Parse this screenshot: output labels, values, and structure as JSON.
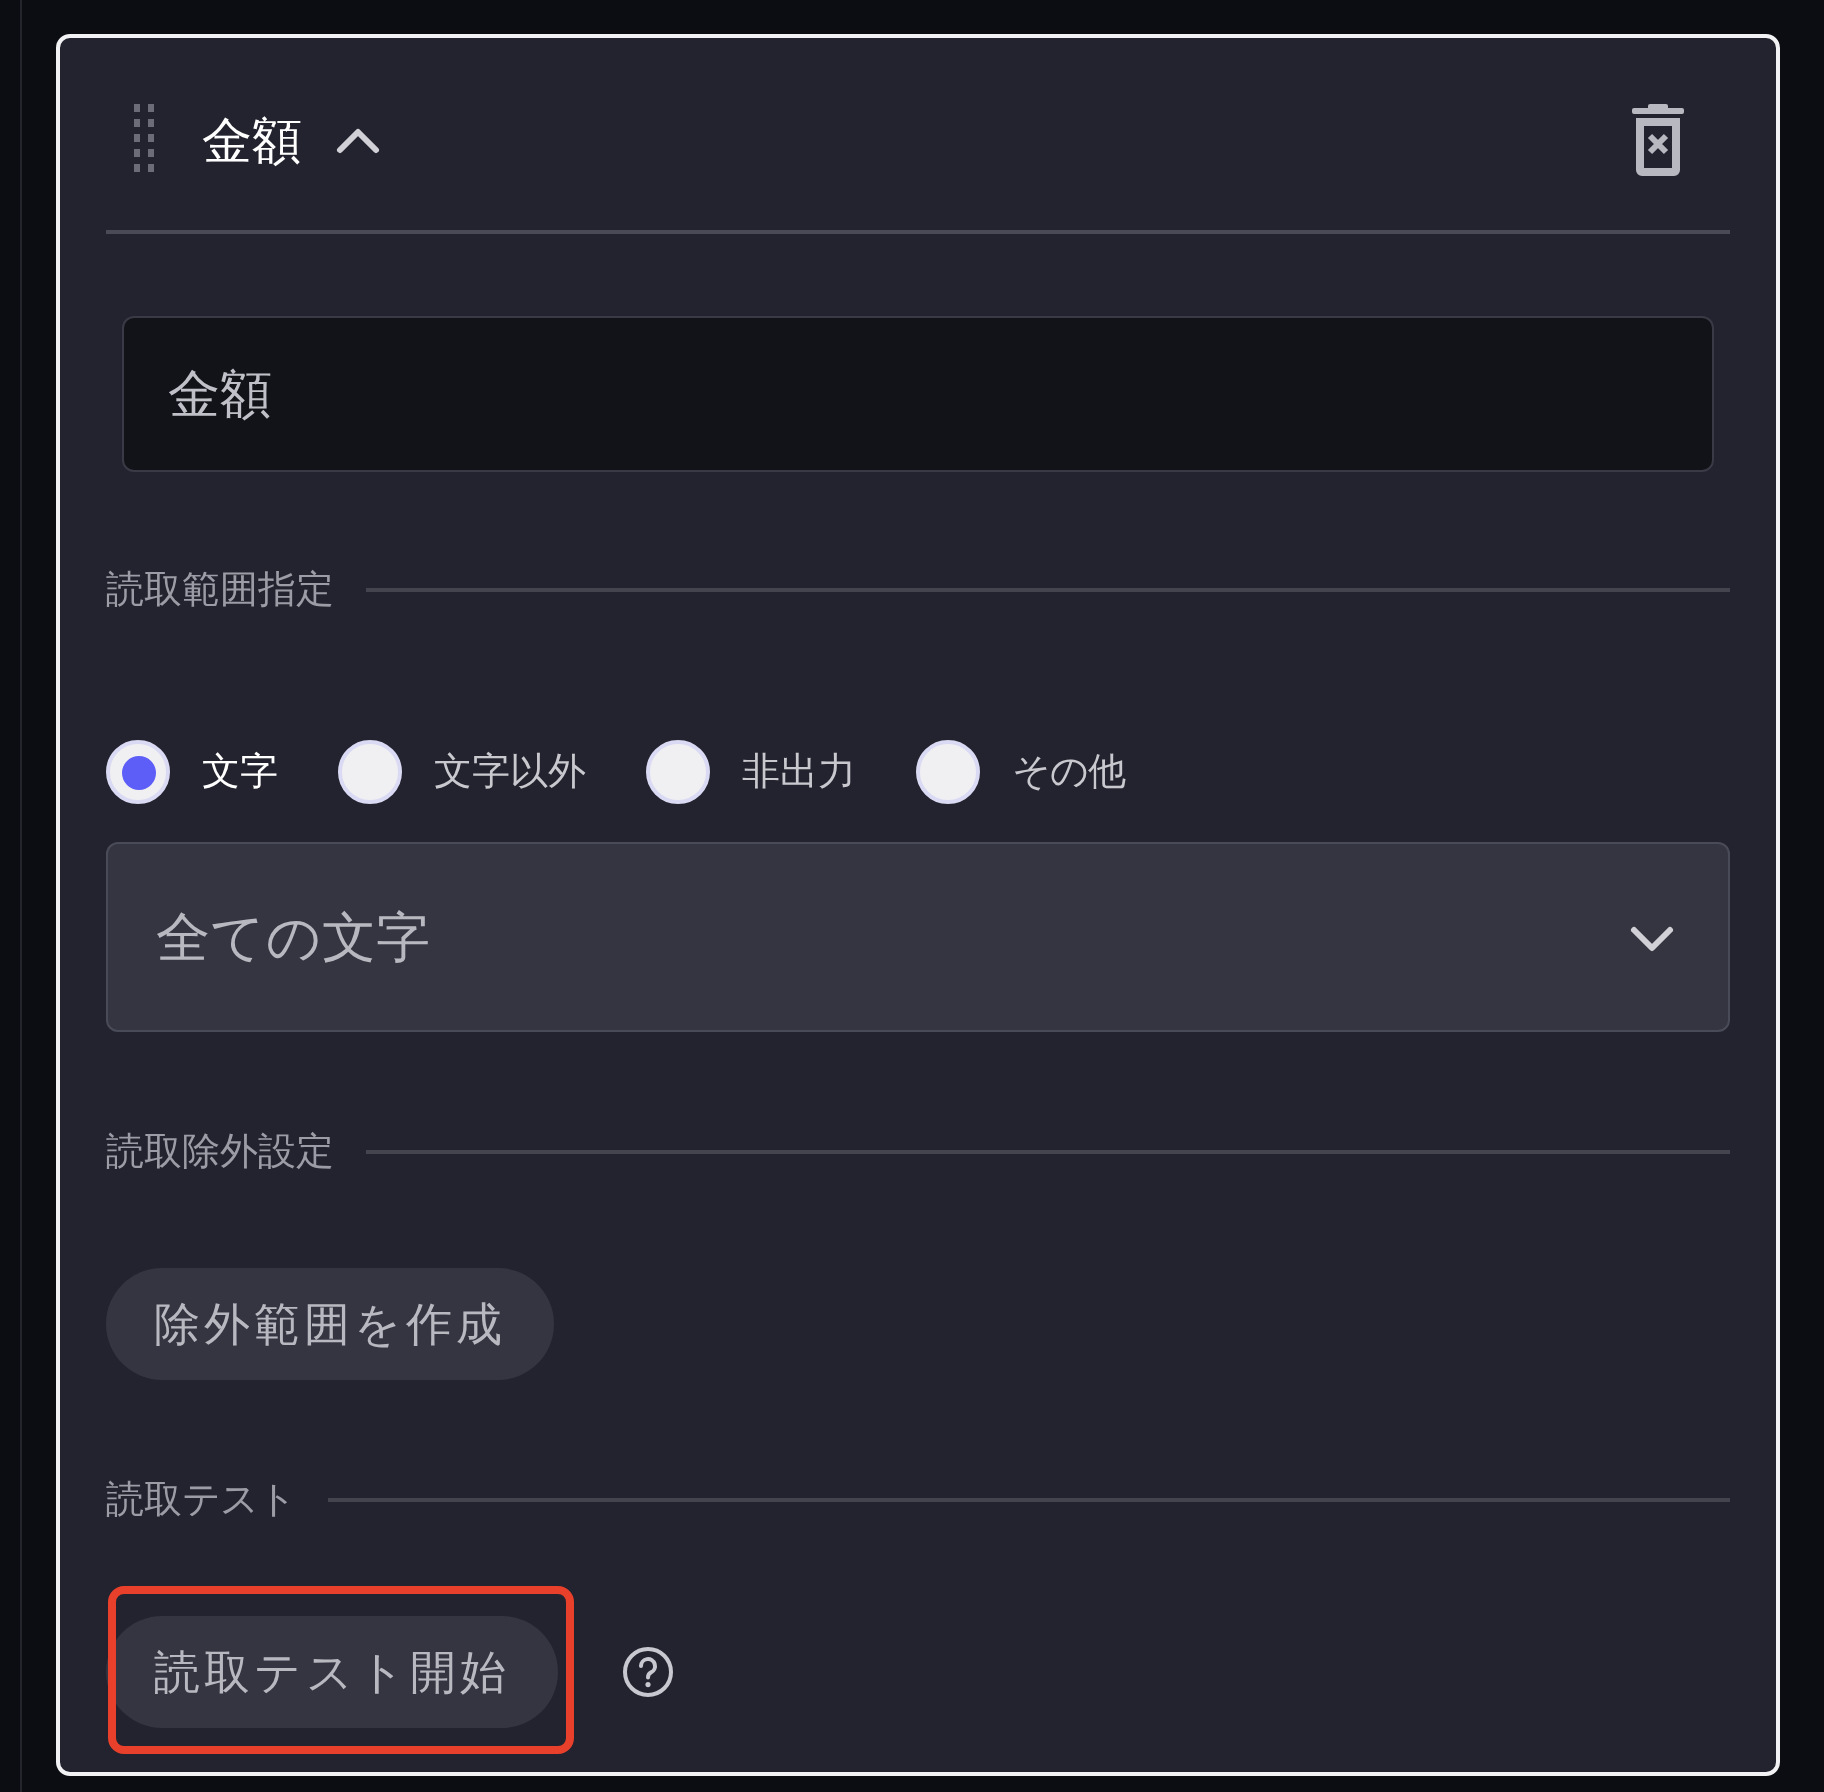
{
  "panel": {
    "title": "金額",
    "expanded": true
  },
  "name_field": {
    "value": "金額"
  },
  "sections": [
    {
      "label": "読取範囲指定",
      "kind": "range"
    },
    {
      "label": "読取除外設定",
      "kind": "exclude"
    },
    {
      "label": "読取テスト",
      "kind": "test"
    }
  ],
  "radios": [
    {
      "label": "文字",
      "selected": true
    },
    {
      "label": "文字以外",
      "selected": false
    },
    {
      "label": "非出力",
      "selected": false
    },
    {
      "label": "その他",
      "selected": false
    }
  ],
  "dropdown": {
    "value": "全ての文字"
  },
  "exclude_button": {
    "label": "除外範囲を作成"
  },
  "test_button": {
    "label": "読取テスト開始",
    "highlighted": true
  }
}
